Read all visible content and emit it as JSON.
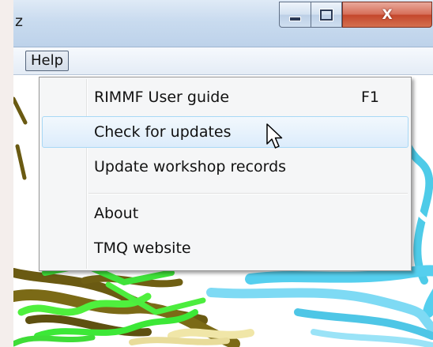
{
  "window": {
    "title": "z",
    "close_glyph": "X",
    "controls": [
      "minimize-icon",
      "maximize-icon",
      "close-icon"
    ]
  },
  "menubar": {
    "help_label": "Help"
  },
  "help_menu": {
    "items": [
      {
        "label": "RIMMF User guide",
        "shortcut": "F1"
      },
      {
        "label": "Check for updates",
        "shortcut": "",
        "highlighted": true
      },
      {
        "label": "Update workshop records",
        "shortcut": ""
      },
      {
        "label": "About",
        "shortcut": ""
      },
      {
        "label": "TMQ website",
        "shortcut": ""
      }
    ]
  },
  "colors": {
    "highlight_border": "#a8d8f5",
    "close_button": "#c4462b",
    "titlebar": "#c9dbef"
  },
  "cursor": "arrow-pointer-icon"
}
